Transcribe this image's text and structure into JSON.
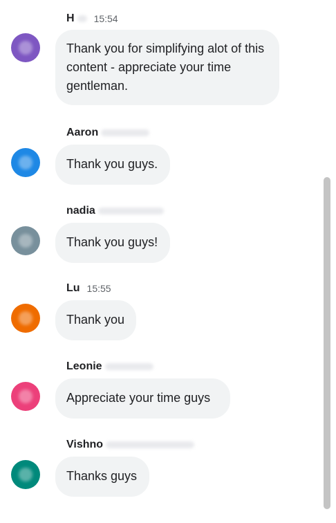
{
  "messages": [
    {
      "name": "H",
      "time": "15:54",
      "text": "Thank you for simplifying alot of this content - appreciate your time gentleman.",
      "avatar_color": "#7e57c2"
    },
    {
      "name": "Aaron",
      "time": "",
      "text": "Thank you guys.",
      "avatar_color": "#1e88e5"
    },
    {
      "name": "nadia",
      "time": "",
      "text": "Thank you guys!",
      "avatar_color": "#78909c"
    },
    {
      "name": "Lu",
      "time": "15:55",
      "text": "Thank you",
      "avatar_color": "#ef6c00"
    },
    {
      "name": "Leonie",
      "time": "",
      "text": "Appreciate your time guys",
      "avatar_color": "#ec407a"
    },
    {
      "name": "Vishno",
      "time": "",
      "text": "Thanks guys",
      "avatar_color": "#00897b"
    }
  ],
  "colors": {
    "bubble": "#f1f3f4",
    "scrollbar_thumb": "#c4c4c4"
  }
}
